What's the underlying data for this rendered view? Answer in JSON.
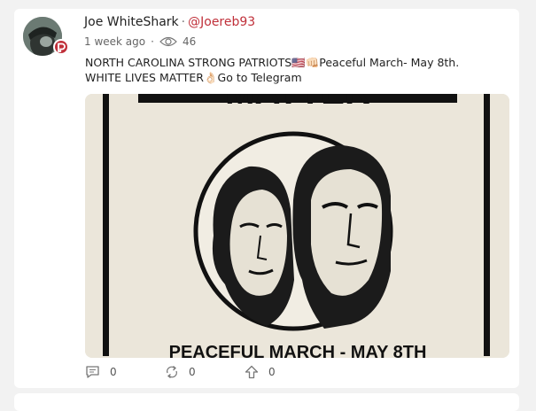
{
  "post": {
    "author_name": "Joe WhiteShark",
    "separator": "·",
    "handle": "@Joereb93",
    "time": "1 week ago",
    "meta_separator": "·",
    "views": "46",
    "text_line1": "NORTH CAROLINA STRONG PATRIOTS🇺🇸👊🏻Peaceful March- May 8th.",
    "text_line2": "WHITE LIVES MATTER👌🏻Go to Telegram",
    "image": {
      "top_text": "MATTER",
      "bottom_text": "PEACEFUL MARCH - MAY 8TH"
    },
    "actions": {
      "comments": "0",
      "echoes": "0",
      "upvotes": "0"
    }
  },
  "icons": {
    "badge": "parler-badge-icon",
    "views": "eye-icon",
    "comment": "comment-icon",
    "echo": "echo-icon",
    "upvote": "upvote-icon"
  },
  "colors": {
    "accent": "#c0303a",
    "background": "#f2f2f2",
    "card": "#ffffff"
  }
}
